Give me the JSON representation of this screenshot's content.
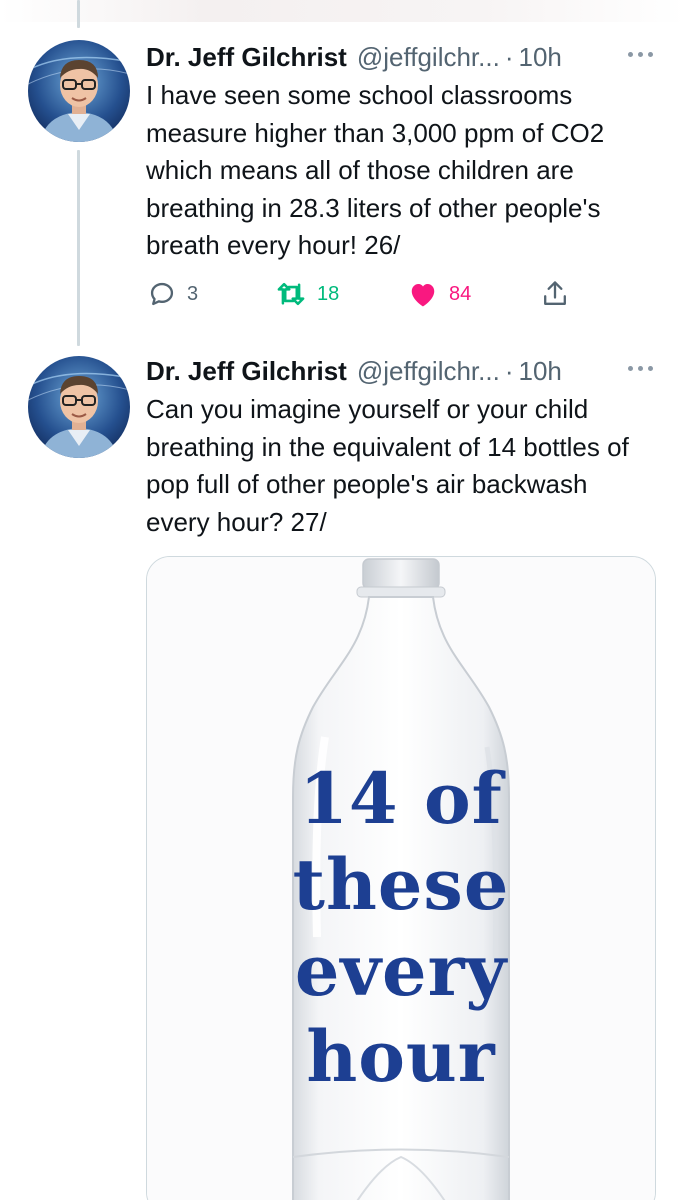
{
  "tweets": [
    {
      "author_name": "Dr. Jeff Gilchrist",
      "handle": "@jeffgilchr...",
      "separator": "·",
      "time": "10h",
      "text": "I have seen some school classrooms measure higher than 3,000 ppm of CO2 which means all of those children are breathing in 28.3 liters of other people's breath every hour! 26/",
      "replies": "3",
      "retweets": "18",
      "likes": "84"
    },
    {
      "author_name": "Dr. Jeff Gilchrist",
      "handle": "@jeffgilchr...",
      "separator": "·",
      "time": "10h",
      "text": "Can you imagine yourself or your child breathing in the equivalent of 14 bottles of pop full of other people's air backwash every hour? 27/",
      "image_text": [
        "14 of",
        "these",
        "every",
        "hour"
      ]
    }
  ],
  "icons": {
    "more": "more-horizontal-icon",
    "reply": "reply-icon",
    "retweet": "retweet-icon",
    "like": "heart-icon",
    "share": "share-icon"
  },
  "colors": {
    "text": "#0f1419",
    "secondary": "#536471",
    "retweet": "#00ba7c",
    "like": "#f91880",
    "thread_line": "#cfd9de",
    "image_text": "#1d3f92"
  }
}
